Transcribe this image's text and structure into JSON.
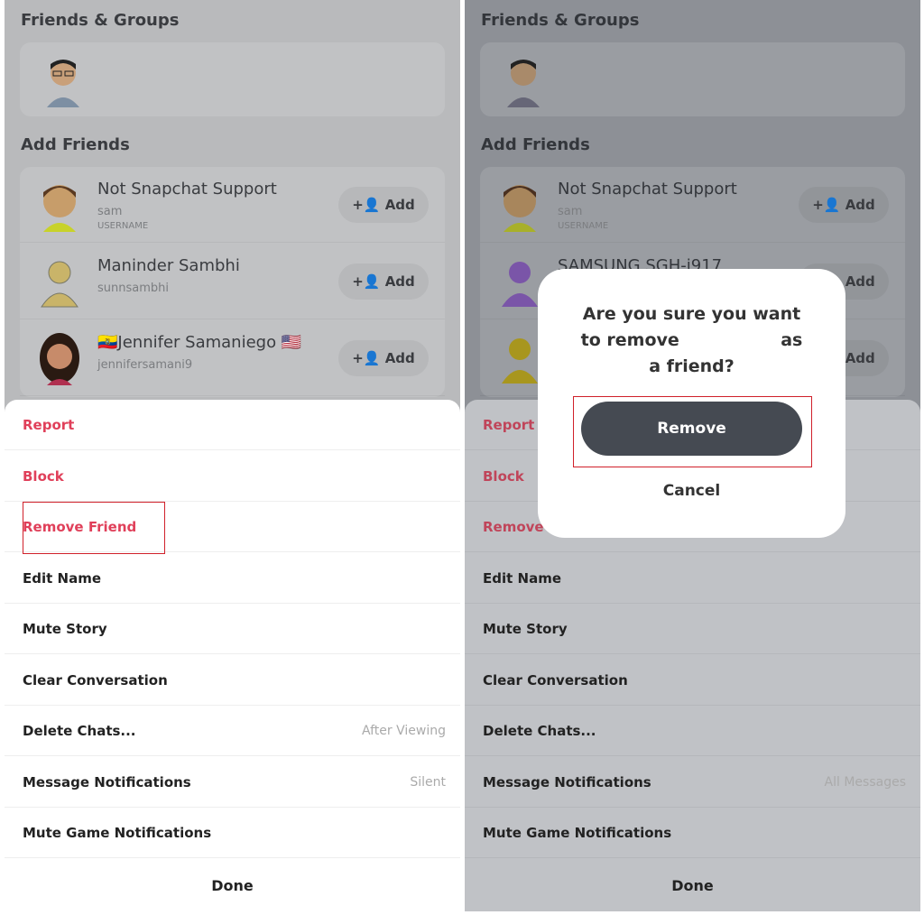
{
  "friends_header": "Friends & Groups",
  "add_friends_header": "Add Friends",
  "add_label": "Add",
  "add_icon": "add-friend-icon",
  "left": {
    "suggestions": [
      {
        "name": "Not Snapchat Support",
        "username": "sam",
        "label": "USERNAME"
      },
      {
        "name": "🇪🇨Jennifer Samaniego 🇺🇸",
        "username": "jennifersamani9",
        "label": ""
      }
    ],
    "middle": {
      "name": "Maninder Sambhi",
      "username": "sunnsambhi",
      "label": ""
    },
    "menu": [
      {
        "label": "Report",
        "red": true
      },
      {
        "label": "Block",
        "red": true
      },
      {
        "label": "Remove Friend",
        "red": true
      },
      {
        "label": "Edit Name"
      },
      {
        "label": "Mute Story"
      },
      {
        "label": "Clear Conversation"
      },
      {
        "label": "Delete Chats...",
        "value": "After Viewing"
      },
      {
        "label": "Message Notifications",
        "value": "Silent"
      },
      {
        "label": "Mute Game Notifications"
      }
    ],
    "done": "Done"
  },
  "right": {
    "suggestions": [
      {
        "name": "Not Snapchat Support",
        "username": "sam",
        "label": "USERNAME"
      },
      {
        "name": "SAMSUNG SGH-i917",
        "username": "",
        "label": ""
      }
    ],
    "menu": [
      {
        "label": "Report",
        "red": true
      },
      {
        "label": "Block",
        "red": true
      },
      {
        "label": "Remove",
        "red": true
      },
      {
        "label": "Edit Name"
      },
      {
        "label": "Mute Story"
      },
      {
        "label": "Clear Conversation"
      },
      {
        "label": "Delete Chats..."
      },
      {
        "label": "Message Notifications",
        "value": "All Messages"
      },
      {
        "label": "Mute Game Notifications"
      }
    ],
    "done": "Done",
    "dialog": {
      "question": "Are you sure you want to remove                 as a friend?",
      "remove": "Remove",
      "cancel": "Cancel"
    }
  }
}
